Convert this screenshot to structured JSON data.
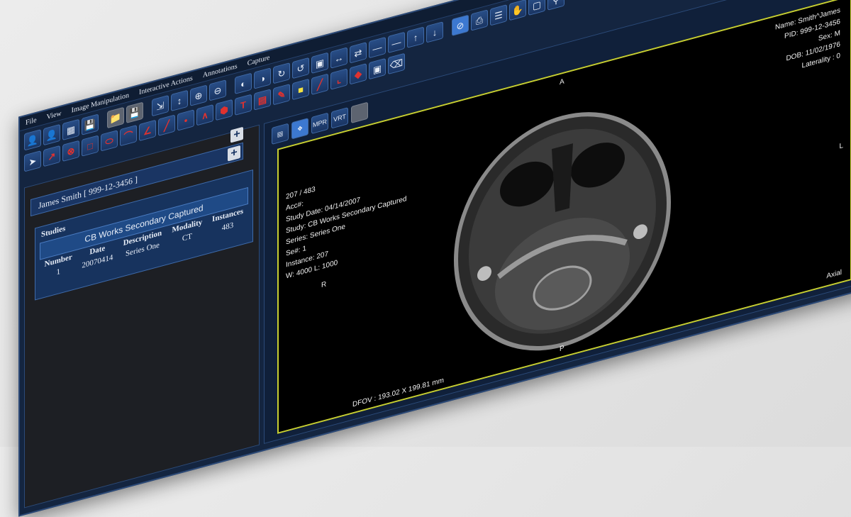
{
  "menu": [
    "File",
    "View",
    "Image Manipulation",
    "Interactive Actions",
    "Annotations",
    "Capture"
  ],
  "patient_bar": "James Smith [ 999-12-3456 ]",
  "studies": {
    "title": "Studies",
    "study_header": "CB Works Secondary Captured",
    "columns": [
      "Number",
      "Date",
      "Description",
      "Modality",
      "Instances"
    ],
    "rows": [
      {
        "number": "1",
        "date": "20070414",
        "description": "Series One",
        "modality": "CT",
        "instances": "483"
      }
    ]
  },
  "overlay": {
    "top_left": [
      "207 / 483",
      "Acc#:",
      "Study Date: 04/14/2007",
      "Study: CB Works Secondary Captured",
      "Series: Series One",
      "Se#: 1",
      "Instance: 207",
      "W: 4000 L: 1000"
    ],
    "top_right": [
      "Name: Smith^James",
      "PID: 999-12-3456",
      "Sex: M",
      "DOB: 11/02/1976",
      "Laterality : 0"
    ],
    "orient_top": "A",
    "orient_bottom": "P",
    "orient_left": "R",
    "orient_right": "L",
    "plane": "Axial",
    "dfov": "DFOV : 193.02 X 199.81 mm"
  },
  "viewer_tool_labels": [
    "MPR",
    "VRT"
  ],
  "colors": {
    "accent": "#3c78d0",
    "frame": "#c7cf32",
    "panel": "#142540",
    "annot_red": "#e0322f"
  }
}
